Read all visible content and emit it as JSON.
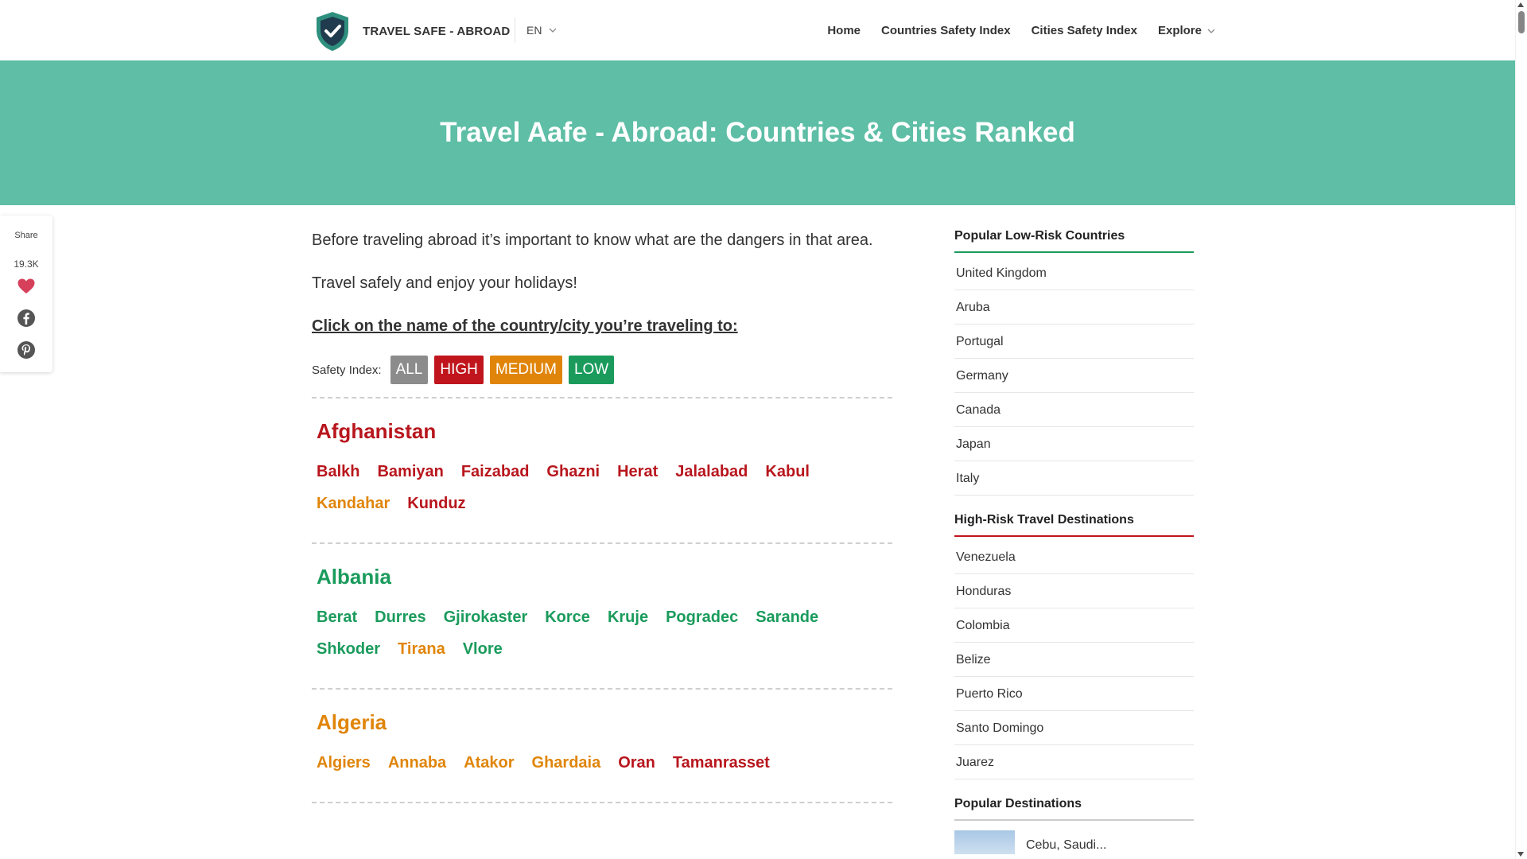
{
  "header": {
    "brand": "TRAVEL SAFE - ABROAD",
    "lang": "EN",
    "nav": [
      {
        "label": "Home"
      },
      {
        "label": "Countries Safety Index"
      },
      {
        "label": "Cities Safety Index"
      },
      {
        "label": "Explore"
      }
    ]
  },
  "hero": {
    "title": "Travel Aafe - Abroad: Countries & Cities Ranked"
  },
  "share": {
    "label": "Share",
    "count": "19.3K"
  },
  "main": {
    "intro1": "Before traveling abroad it’s important to know what are the dangers in that area.",
    "intro2": "Travel safely and enjoy your holidays!",
    "cta": "Click on the name of the country/city you’re traveling to:",
    "filter_label": "Safety Index:",
    "filters": [
      {
        "label": "ALL",
        "color": "#8c8c8c"
      },
      {
        "label": "HIGH",
        "color": "#c0151c"
      },
      {
        "label": "MEDIUM",
        "color": "#e0850a"
      },
      {
        "label": "LOW",
        "color": "#1a9b5c"
      }
    ],
    "countries": [
      {
        "name": "Afghanistan",
        "color": "#b8161d",
        "cities": [
          {
            "name": "Balkh",
            "color": "#b8161d"
          },
          {
            "name": "Bamiyan",
            "color": "#b8161d"
          },
          {
            "name": "Faizabad",
            "color": "#b8161d"
          },
          {
            "name": "Ghazni",
            "color": "#b8161d"
          },
          {
            "name": "Herat",
            "color": "#b8161d"
          },
          {
            "name": "Jalalabad",
            "color": "#b8161d"
          },
          {
            "name": "Kabul",
            "color": "#b8161d"
          },
          {
            "name": "Kandahar",
            "color": "#e0850a"
          },
          {
            "name": "Kunduz",
            "color": "#b8161d"
          }
        ]
      },
      {
        "name": "Albania",
        "color": "#1a9b5c",
        "cities": [
          {
            "name": "Berat",
            "color": "#1a9b5c"
          },
          {
            "name": "Durres",
            "color": "#1a9b5c"
          },
          {
            "name": "Gjirokaster",
            "color": "#1a9b5c"
          },
          {
            "name": "Korce",
            "color": "#1a9b5c"
          },
          {
            "name": "Kruje",
            "color": "#1a9b5c"
          },
          {
            "name": "Pogradec",
            "color": "#1a9b5c"
          },
          {
            "name": "Sarande",
            "color": "#1a9b5c"
          },
          {
            "name": "Shkoder",
            "color": "#1a9b5c"
          },
          {
            "name": "Tirana",
            "color": "#e0850a"
          },
          {
            "name": "Vlore",
            "color": "#1a9b5c"
          }
        ]
      },
      {
        "name": "Algeria",
        "color": "#e0850a",
        "cities": [
          {
            "name": "Algiers",
            "color": "#e0850a"
          },
          {
            "name": "Annaba",
            "color": "#e0850a"
          },
          {
            "name": "Atakor",
            "color": "#e0850a"
          },
          {
            "name": "Ghardaia",
            "color": "#e0850a"
          },
          {
            "name": "Oran",
            "color": "#b8161d"
          },
          {
            "name": "Tamanrasset",
            "color": "#b8161d"
          }
        ]
      }
    ]
  },
  "sidebar": {
    "low_risk": {
      "title": "Popular Low-Risk Countries",
      "accent": "#1a9b5c",
      "items": [
        "United Kingdom",
        "Aruba",
        "Portugal",
        "Germany",
        "Canada",
        "Japan",
        "Italy"
      ]
    },
    "high_risk": {
      "title": "High-Risk Travel Destinations",
      "accent": "#c0151c",
      "items": [
        "Venezuela",
        "Honduras",
        "Colombia",
        "Belize",
        "Puerto Rico",
        "Santo Domingo",
        "Juarez"
      ]
    },
    "popular": {
      "title": "Popular Destinations",
      "accent": "#cccccc",
      "first_item": "Cebu, Saudi..."
    }
  }
}
